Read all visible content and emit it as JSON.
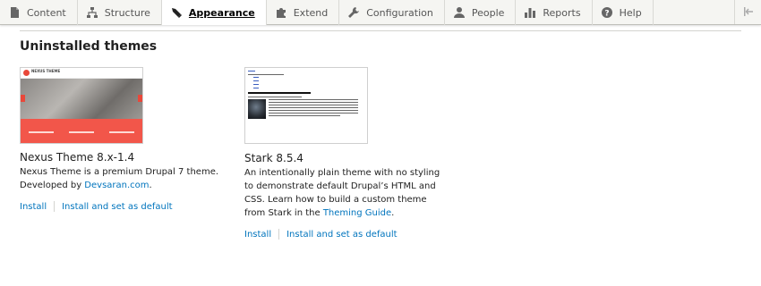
{
  "toolbar": {
    "items": [
      {
        "label": "Content",
        "icon": "file-icon"
      },
      {
        "label": "Structure",
        "icon": "sitemap-icon"
      },
      {
        "label": "Appearance",
        "icon": "paintbrush-icon",
        "active": true
      },
      {
        "label": "Extend",
        "icon": "puzzle-icon"
      },
      {
        "label": "Configuration",
        "icon": "wrench-icon"
      },
      {
        "label": "People",
        "icon": "person-icon"
      },
      {
        "label": "Reports",
        "icon": "bar-chart-icon"
      },
      {
        "label": "Help",
        "icon": "help-icon"
      }
    ],
    "toggle_icon": "collapse-icon"
  },
  "section": {
    "title": "Uninstalled themes"
  },
  "themes": {
    "nexus": {
      "name": "Nexus Theme 8.x-1.4",
      "desc_1": "Nexus Theme is a premium Drupal 7 theme.",
      "desc_2_prefix": "Developed by ",
      "desc_2_link": "Devsaran.com",
      "desc_2_suffix": ".",
      "screenshot_brand": "NEXUS THEME",
      "install": "Install",
      "install_default": "Install and set as default"
    },
    "stark": {
      "name": "Stark 8.5.4",
      "desc_prefix": "An intentionally plain theme with no styling to demonstrate default Drupal’s HTML and CSS. Learn how to build a custom theme from Stark in the ",
      "desc_link": "Theming Guide",
      "desc_suffix": ".",
      "install": "Install",
      "install_default": "Install and set as default"
    }
  },
  "colors": {
    "link": "#0074bd",
    "accent": "#f2564a"
  }
}
